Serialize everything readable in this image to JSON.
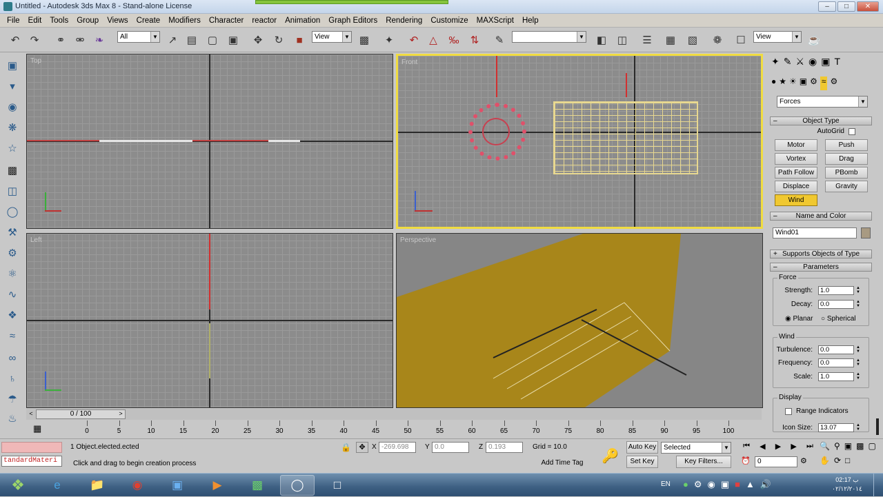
{
  "window": {
    "title": "Untitled - Autodesk 3ds Max 8 - Stand-alone License"
  },
  "menu": [
    "File",
    "Edit",
    "Tools",
    "Group",
    "Views",
    "Create",
    "Modifiers",
    "Character",
    "reactor",
    "Animation",
    "Graph Editors",
    "Rendering",
    "Customize",
    "MAXScript",
    "Help"
  ],
  "toolbar": {
    "selection_filter": "All",
    "ref_coord": "View",
    "named_sel": "",
    "view_right": "View"
  },
  "viewports": {
    "top": "Top",
    "front": "Front",
    "left": "Left",
    "perspective": "Perspective"
  },
  "command_panel": {
    "category": "Forces",
    "object_type": {
      "title": "Object Type",
      "autogrid": "AutoGrid",
      "buttons": [
        "Motor",
        "Push",
        "Vortex",
        "Drag",
        "Path Follow",
        "PBomb",
        "Displace",
        "Gravity",
        "Wind"
      ],
      "active": "Wind"
    },
    "name_color": {
      "title": "Name and Color",
      "name": "Wind01",
      "swatch": "#a89a82"
    },
    "supports": "Supports Objects of Type",
    "parameters": {
      "title": "Parameters",
      "force": {
        "label": "Force",
        "strength_label": "Strength:",
        "strength": "1.0",
        "decay_label": "Decay:",
        "decay": "0.0",
        "planar": "Planar",
        "spherical": "Spherical"
      },
      "wind": {
        "label": "Wind",
        "turbulence_label": "Turbulence:",
        "turbulence": "0.0",
        "frequency_label": "Frequency:",
        "frequency": "0.0",
        "scale_label": "Scale:",
        "scale": "1.0"
      },
      "display": {
        "label": "Display",
        "range_label": "Range Indicators",
        "icon_size_label": "Icon Size:",
        "icon_size": "13.07"
      }
    }
  },
  "timeline": {
    "frame": "0 / 100",
    "ticks": [
      "0",
      "5",
      "10",
      "15",
      "20",
      "25",
      "30",
      "35",
      "40",
      "45",
      "50",
      "55",
      "60",
      "65",
      "70",
      "75",
      "80",
      "85",
      "90",
      "95",
      "100"
    ]
  },
  "status": {
    "material": "tandardMateri",
    "selection": "1 Object.elected.ected",
    "prompt": "Click and drag to begin creation process",
    "x_label": "X",
    "x": "-269.698",
    "y_label": "Y",
    "y": "0.0",
    "z_label": "Z",
    "z": "0.193",
    "grid": "Grid = 10.0",
    "add_time_tag": "Add Time Tag",
    "auto_key": "Auto Key",
    "set_key": "Set Key",
    "key_mode": "Selected",
    "key_filters": "Key Filters...",
    "current_frame": "0"
  },
  "taskbar": {
    "lang": "EN",
    "time": "02:17 ب",
    "date": "٠٢/١٢/٢٠١٤"
  }
}
